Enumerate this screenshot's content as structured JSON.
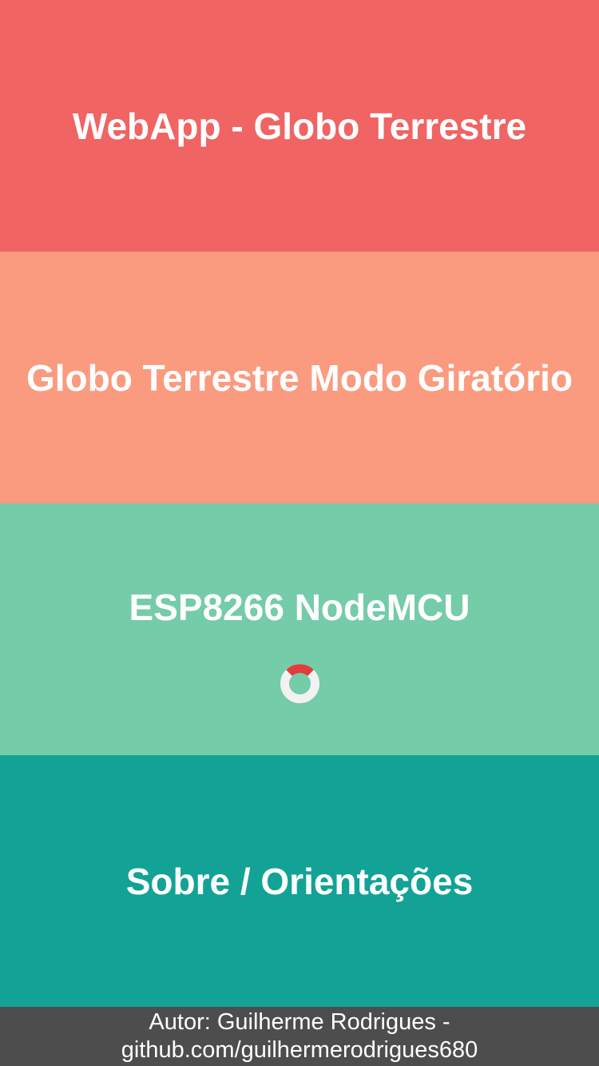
{
  "menu": {
    "items": [
      {
        "label": "WebApp - Globo Terrestre",
        "color": "#f06464"
      },
      {
        "label": "Globo Terrestre Modo Giratório",
        "color": "#fa9b80"
      },
      {
        "label": "ESP8266 NodeMCU",
        "color": "#74cca8"
      },
      {
        "label": "Sobre / Orientações",
        "color": "#12a396"
      }
    ]
  },
  "status": {
    "indicator_icon": "loading-spinner-icon",
    "indicator_colors": {
      "track": "#f2f2f2",
      "arc": "#e03c3c"
    }
  },
  "footer": {
    "line1": "Autor: Guilherme Rodrigues -",
    "line2": "github.com/guilhermerodrigues680",
    "background": "#4d4d4d"
  }
}
